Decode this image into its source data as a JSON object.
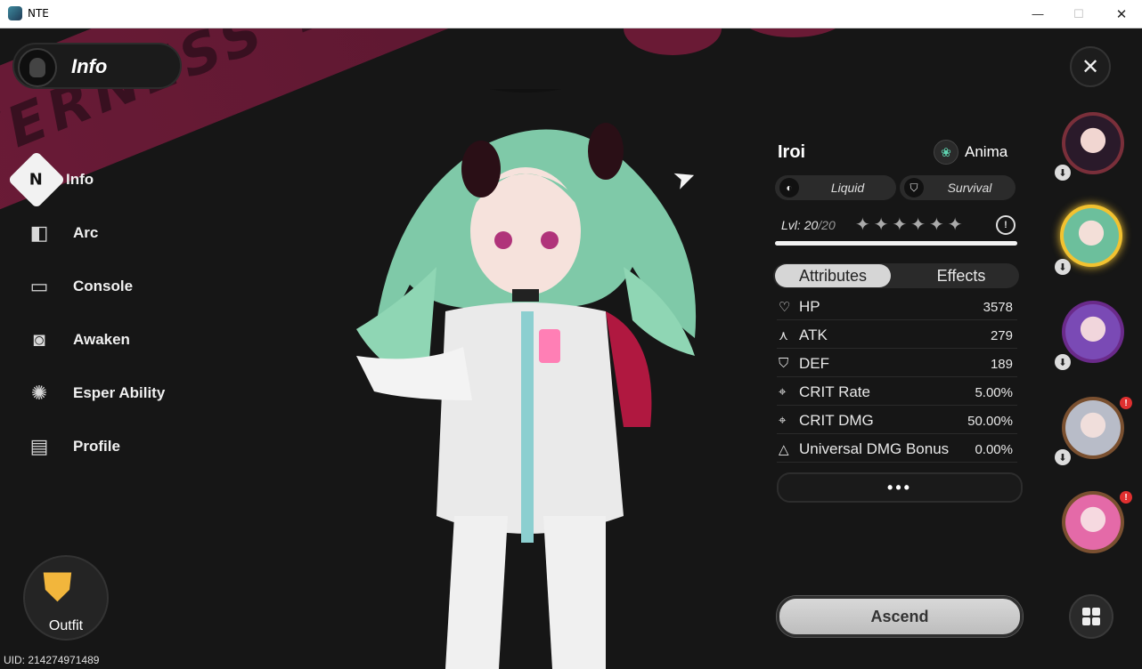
{
  "window": {
    "title": "NTE"
  },
  "header": {
    "label": "Info"
  },
  "banner_text": "EVERNESS TO EVERNESS",
  "sidebar": {
    "items": [
      {
        "label": "Info",
        "icon": "info-emblem-icon",
        "glyph": "N"
      },
      {
        "label": "Arc",
        "icon": "arc-icon",
        "glyph": "◧"
      },
      {
        "label": "Console",
        "icon": "console-icon",
        "glyph": "▭"
      },
      {
        "label": "Awaken",
        "icon": "awaken-icon",
        "glyph": "◙"
      },
      {
        "label": "Esper Ability",
        "icon": "esper-ability-icon",
        "glyph": "✺"
      },
      {
        "label": "Profile",
        "icon": "profile-icon",
        "glyph": "▤"
      }
    ]
  },
  "outfit": {
    "label": "Outfit"
  },
  "uid": "UID: 214274971489",
  "character": {
    "name": "Iroi",
    "element": "Anima",
    "tags": [
      "Liquid",
      "Survival"
    ],
    "level_prefix": "Lvl: ",
    "level": "20",
    "level_max": "/20",
    "stars": "✦✦✦✦✦✦",
    "level_progress": 1.0
  },
  "tabs": [
    "Attributes",
    "Effects"
  ],
  "stats": [
    {
      "name": "HP",
      "value": "3578",
      "icon": "heart-icon",
      "glyph": "♡"
    },
    {
      "name": "ATK",
      "value": "279",
      "icon": "atk-icon",
      "glyph": "⋏"
    },
    {
      "name": "DEF",
      "value": "189",
      "icon": "shield-icon",
      "glyph": "⛉"
    },
    {
      "name": "CRIT Rate",
      "value": "5.00%",
      "icon": "crit-rate-icon",
      "glyph": "⌖"
    },
    {
      "name": "CRIT DMG",
      "value": "50.00%",
      "icon": "crit-dmg-icon",
      "glyph": "⌖"
    },
    {
      "name": "Universal DMG Bonus",
      "value": "0.00%",
      "icon": "triangle-icon",
      "glyph": "△"
    }
  ],
  "more_label": "•••",
  "ascend_label": "Ascend",
  "colors": {
    "accent": "#7a1c3d",
    "outfit_icon": "#f2b63c",
    "selected_ring": "#f2c230",
    "alert": "#e03030"
  }
}
